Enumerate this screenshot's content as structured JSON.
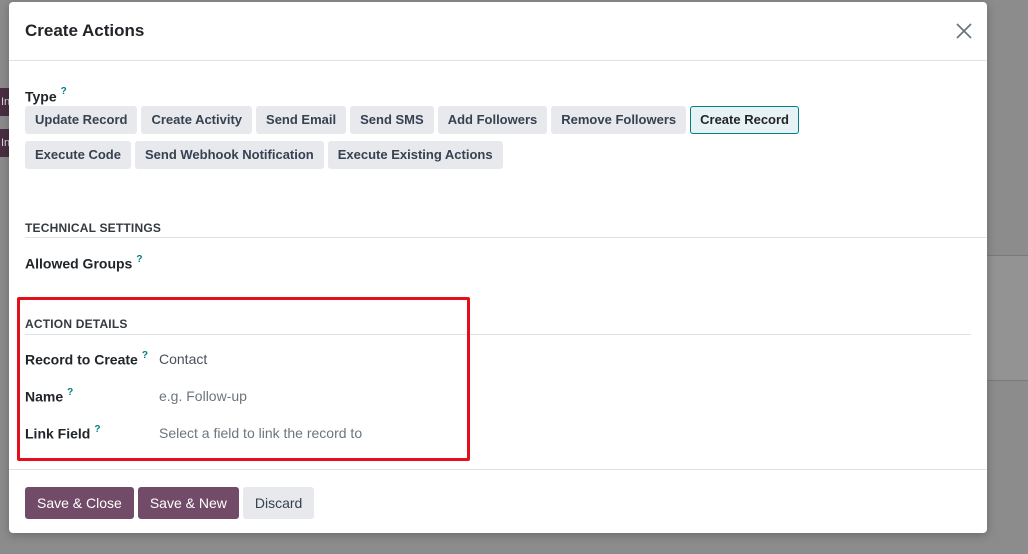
{
  "dialog": {
    "title": "Create Actions",
    "close_icon": "close-icon"
  },
  "type_field": {
    "label": "Type",
    "help": "?",
    "options": [
      {
        "label": "Update Record",
        "active": false
      },
      {
        "label": "Create Activity",
        "active": false
      },
      {
        "label": "Send Email",
        "active": false
      },
      {
        "label": "Send SMS",
        "active": false
      },
      {
        "label": "Add Followers",
        "active": false
      },
      {
        "label": "Remove Followers",
        "active": false
      },
      {
        "label": "Create Record",
        "active": true
      },
      {
        "label": "Execute Code",
        "active": false
      },
      {
        "label": "Send Webhook Notification",
        "active": false
      },
      {
        "label": "Execute Existing Actions",
        "active": false
      }
    ]
  },
  "technical_settings": {
    "title": "TECHNICAL SETTINGS",
    "allowed_groups": {
      "label": "Allowed Groups",
      "help": "?",
      "value": ""
    }
  },
  "action_details": {
    "title": "ACTION DETAILS",
    "record_to_create": {
      "label": "Record to Create",
      "help": "?",
      "value": "Contact"
    },
    "name": {
      "label": "Name",
      "help": "?",
      "value": "",
      "placeholder": "e.g. Follow-up"
    },
    "link_field": {
      "label": "Link Field",
      "help": "?",
      "value": "",
      "placeholder": "Select a field to link the record to"
    }
  },
  "footer": {
    "save_close": "Save & Close",
    "save_new": "Save & New",
    "discard": "Discard"
  },
  "colors": {
    "primary": "#714b67",
    "active_border": "#017e84",
    "highlight": "#e3101b"
  }
}
